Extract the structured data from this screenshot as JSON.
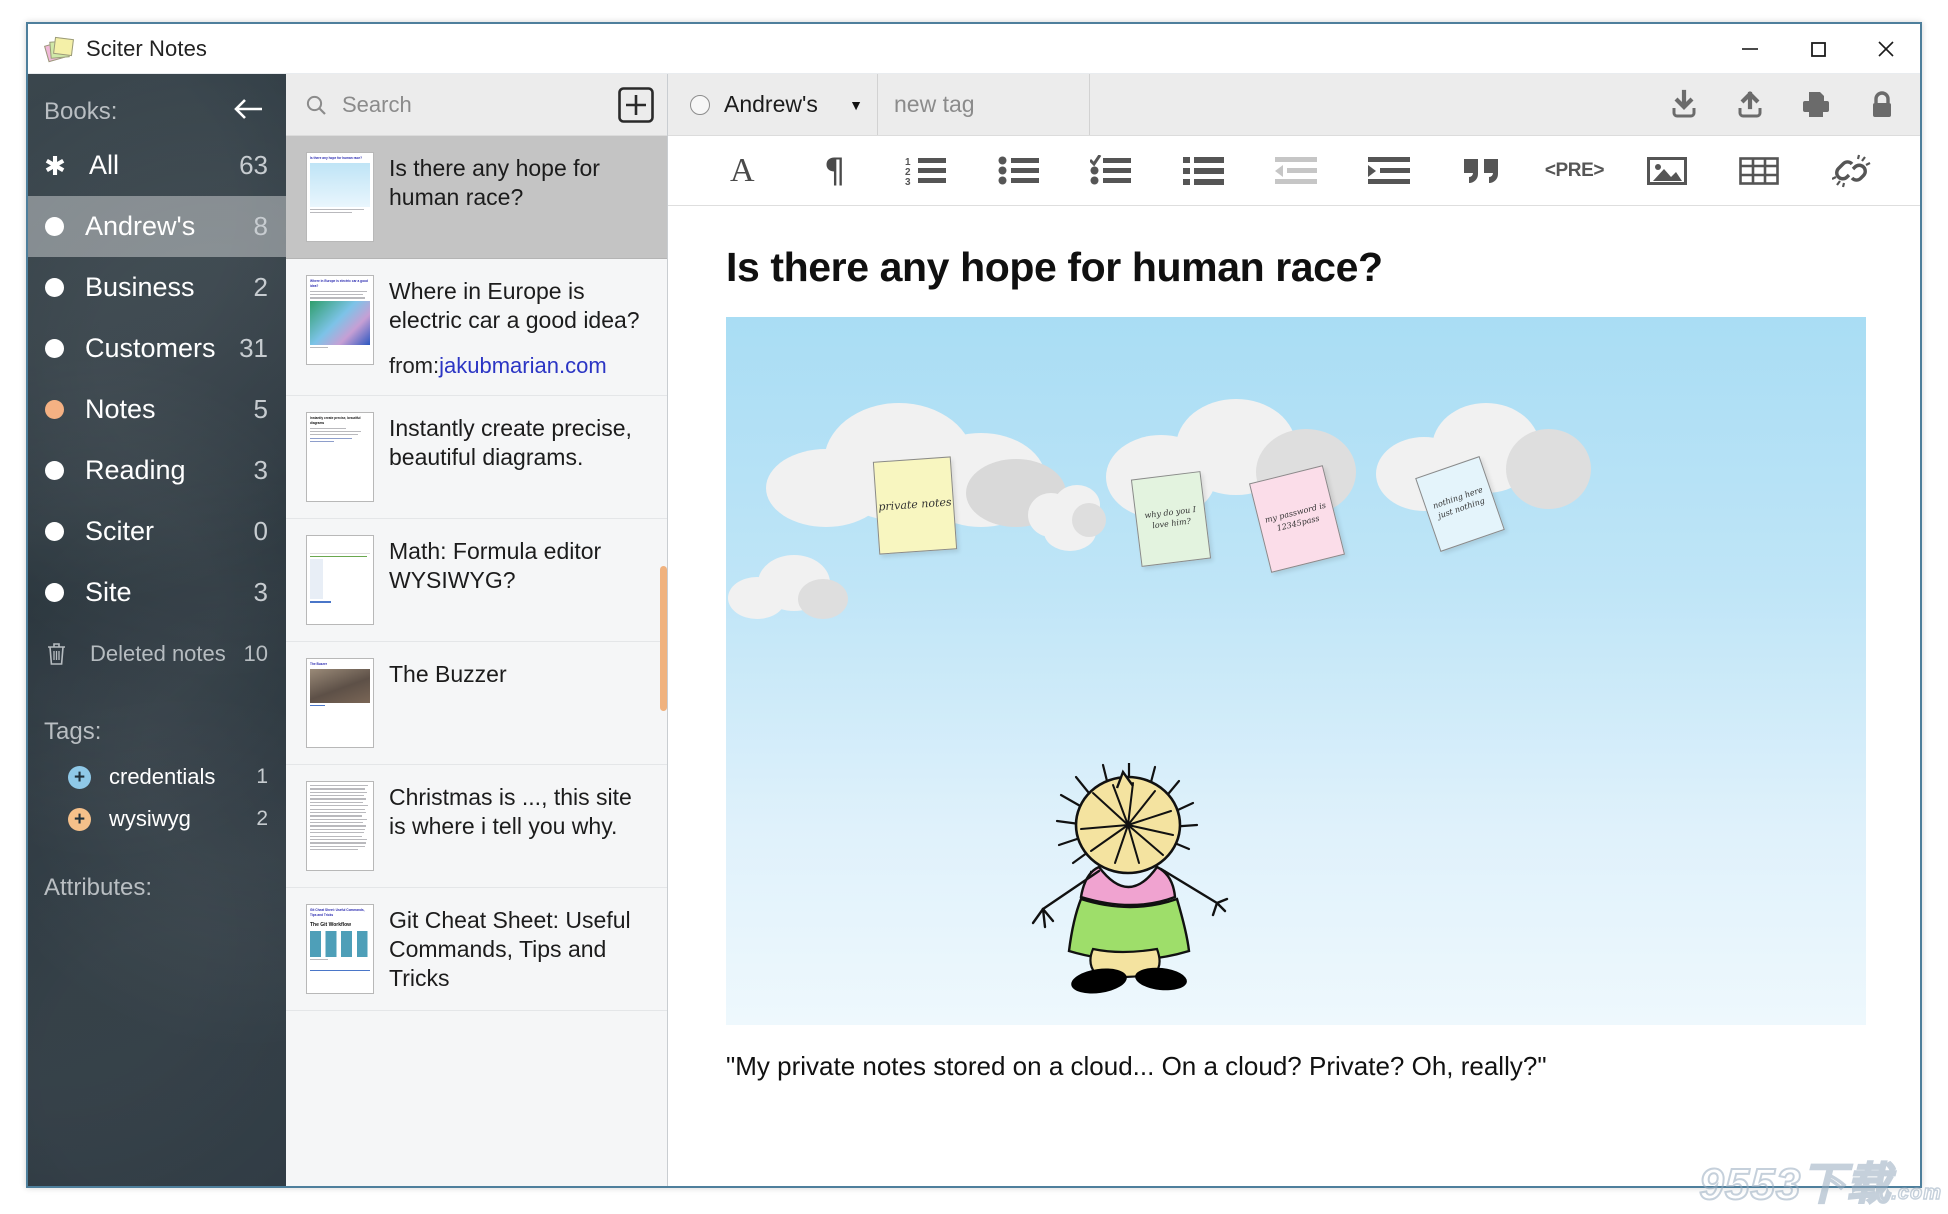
{
  "window": {
    "title": "Sciter Notes",
    "icon": "sticky-notes-icon",
    "controls": {
      "minimize": "–",
      "maximize": "□",
      "close": "✕"
    }
  },
  "sidebar": {
    "books_heading": "Books:",
    "collapse_icon": "arrow-left-icon",
    "books": [
      {
        "label": "All",
        "count": "63",
        "marker": "asterisk",
        "selected": false
      },
      {
        "label": "Andrew's",
        "count": "8",
        "marker": "dot",
        "selected": true
      },
      {
        "label": "Business",
        "count": "2",
        "marker": "dot",
        "selected": false
      },
      {
        "label": "Customers",
        "count": "31",
        "marker": "dot",
        "selected": false
      },
      {
        "label": "Notes",
        "count": "5",
        "marker": "dot-orange",
        "selected": false
      },
      {
        "label": "Reading",
        "count": "3",
        "marker": "dot",
        "selected": false
      },
      {
        "label": "Sciter",
        "count": "0",
        "marker": "dot",
        "selected": false
      },
      {
        "label": "Site",
        "count": "3",
        "marker": "dot",
        "selected": false
      }
    ],
    "deleted": {
      "label": "Deleted notes",
      "count": "10",
      "icon": "trash-icon"
    },
    "tags_heading": "Tags:",
    "tags": [
      {
        "label": "credentials",
        "count": "1",
        "color": "#8fc9e8"
      },
      {
        "label": "wysiwyg",
        "count": "2",
        "color": "#f5c08a"
      }
    ],
    "attributes_heading": "Attributes:"
  },
  "notelist": {
    "search": {
      "placeholder": "Search",
      "value": "",
      "icon": "search-icon"
    },
    "add_button": {
      "label": "+",
      "icon": "plus-square-icon"
    },
    "notes": [
      {
        "title": "Is there any hope for human race?",
        "from_label": "",
        "from_link": "",
        "selected": true,
        "thumb": "cloud-illustration"
      },
      {
        "title": "Where in Europe is electric car a good idea?",
        "from_label": "from:",
        "from_link": "jakubmarian.com",
        "selected": false,
        "thumb": "europe-map"
      },
      {
        "title": "Instantly create precise, beautiful diagrams.",
        "from_label": "",
        "from_link": "",
        "selected": false,
        "thumb": "text-document"
      },
      {
        "title": "Math: Formula editor WYSIWYG?",
        "from_label": "",
        "from_link": "",
        "selected": false,
        "thumb": "formula-page"
      },
      {
        "title": "The Buzzer",
        "from_label": "",
        "from_link": "",
        "selected": false,
        "thumb": "radio-photo"
      },
      {
        "title": "Christmas is ..., this site is where i tell you why.",
        "from_label": "",
        "from_link": "",
        "selected": false,
        "thumb": "dense-text"
      },
      {
        "title": "Git Cheat Sheet: Useful Commands, Tips and Tricks",
        "from_label": "",
        "from_link": "",
        "selected": false,
        "thumb": "git-workflow"
      }
    ],
    "scrollbar_color": "#f0b27e"
  },
  "editor": {
    "meta": {
      "book": {
        "value": "Andrew's",
        "caret": "▼",
        "marker_icon": "circle-outline-icon"
      },
      "tag_input": {
        "placeholder": "new tag",
        "value": ""
      },
      "actions": [
        {
          "name": "import-icon",
          "label": "download-arrow-into-tray"
        },
        {
          "name": "export-icon",
          "label": "upload-arrow-out-of-tray"
        },
        {
          "name": "print-icon",
          "label": "printer"
        },
        {
          "name": "lock-icon",
          "label": "padlock"
        }
      ]
    },
    "format_buttons": [
      {
        "name": "font-style-icon",
        "label": "A",
        "dim": false
      },
      {
        "name": "paragraph-icon",
        "label": "¶",
        "dim": false
      },
      {
        "name": "ordered-list-icon",
        "label": "1 2 3 list",
        "dim": false
      },
      {
        "name": "bullet-list-icon",
        "label": "bullet list",
        "dim": false
      },
      {
        "name": "checklist-icon",
        "label": "check list",
        "dim": false
      },
      {
        "name": "definition-list-icon",
        "label": "block list",
        "dim": false
      },
      {
        "name": "outdent-icon",
        "label": "outdent",
        "dim": true
      },
      {
        "name": "indent-icon",
        "label": "indent",
        "dim": false
      },
      {
        "name": "blockquote-icon",
        "label": "❝",
        "dim": false
      },
      {
        "name": "preformatted-icon",
        "label": "<PRE>",
        "dim": false
      },
      {
        "name": "insert-image-icon",
        "label": "image",
        "dim": false
      },
      {
        "name": "insert-table-icon",
        "label": "table",
        "dim": false
      },
      {
        "name": "clear-formatting-icon",
        "label": "unlink",
        "dim": false
      }
    ],
    "document": {
      "title": "Is there any hope for human race?",
      "caption": "\"My private notes stored on a cloud... On a cloud? Private? Oh, really?\"",
      "illustration": {
        "alt": "Clouds with sticky notes and a cartoon figure",
        "sky_top": "#a9ddf4",
        "sky_bottom": "#eef8fd",
        "sticky_notes": [
          {
            "text": "private notes",
            "color": "#f8f6c0",
            "rotate": "-5"
          },
          {
            "text": "why do you\nI love him?",
            "color": "#e3f3df",
            "rotate": "-8"
          },
          {
            "text": "my password\nis 12345pass",
            "color": "#fbdde9",
            "rotate": "-14"
          },
          {
            "text": "nothing here\njust nothing",
            "color": "#e4f4fb",
            "rotate": "-18"
          }
        ]
      }
    }
  },
  "watermark": {
    "text": "9553",
    "suffix": "下载",
    "domain": ".com"
  }
}
